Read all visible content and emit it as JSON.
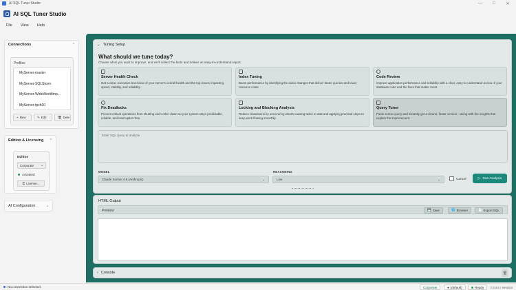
{
  "window": {
    "title": "AI SQL Tuner Studio"
  },
  "app": {
    "title": "AI SQL Tuner Studio"
  },
  "menu": [
    "File",
    "View",
    "Help"
  ],
  "connections": {
    "title": "Connections",
    "profiles_label": "Profiles",
    "profiles": [
      "MyServer-master",
      "MyServer-SQLStorm",
      "MyServer-WideWorldImp...",
      "MyServer-tpch10"
    ],
    "buttons": {
      "new": "New",
      "edit": "Edit",
      "delete": "Dele"
    }
  },
  "edition": {
    "title": "Edition & Licensing",
    "label": "Edition",
    "value": "Corporate",
    "status": "Activated",
    "license_button": "License..."
  },
  "ai_config": {
    "title": "AI Configuration"
  },
  "tuning": {
    "section_title": "Tuning Setup",
    "question": "What should we tune today?",
    "subtitle": "Choose what you want to improve, and we'll collect the facts and deliver an easy-to-understand report.",
    "cards": [
      {
        "title": "Server Health Check",
        "desc": "Get a clear, executive-level view of your server's overall health and the top issues impacting speed, stability, and reliability."
      },
      {
        "title": "Index Tuning",
        "desc": "Boost performance by identifying the index changes that deliver faster queries and lower resource costs."
      },
      {
        "title": "Code Review",
        "desc": "Improve application performance and reliability with a clear, easy-to-understand review of your database code and the fixes that matter most."
      },
      {
        "title": "Fix Deadlocks",
        "desc": "Prevent critical operations from shutting each other down so your system stays predictable, reliable, and interruption-free."
      },
      {
        "title": "Locking and Blocking Analysis",
        "desc": "Reduce slowdowns by uncovering what's causing tasks to wait and applying practical steps to keep work flowing smoothly."
      },
      {
        "title": "Query Tuner",
        "desc": "Paste a slow query and instantly get a clearer, faster version—along with the insights that explain the improvement."
      }
    ],
    "sql_placeholder": "Enter SQL query to analyze",
    "model_label": "MODEL",
    "model_value": "Claude Sonnet 4.6 (Anthropic)",
    "reasoning_label": "REASONING",
    "reasoning_value": "Low",
    "cancel_label": "Cancel",
    "run_label": "Run Analysis"
  },
  "output": {
    "title": "HTML Output",
    "preview_label": "Preview",
    "save_label": "Save",
    "browser_label": "Browser",
    "export_label": "Export SQL"
  },
  "console": {
    "title": "Console"
  },
  "status": {
    "connection": "No connection selected",
    "edition": "Corporate",
    "user": "(default)",
    "ready": "Ready",
    "usage": "0 runs / session"
  },
  "colors": {
    "accent": "#1b8a7c",
    "main_bg": "#1e6e64",
    "ready": "#2e9e60",
    "no_connection": "#2d6fd1"
  }
}
